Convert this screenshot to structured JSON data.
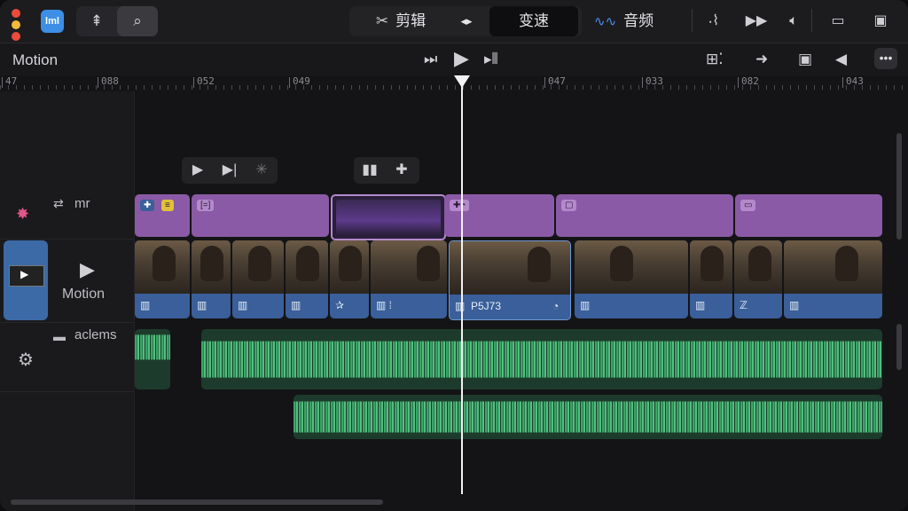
{
  "toolbar": {
    "traffic_colors": [
      "#e94b3c",
      "#f2b93b",
      "#e94b3c"
    ],
    "app_icon_label": "lml",
    "tools": [
      {
        "icon": "arrow-up-icon",
        "glyph": "⇞"
      },
      {
        "icon": "search-icon",
        "glyph": "⌕"
      }
    ],
    "segments": [
      {
        "label": "剪辑",
        "glyph": "✂",
        "selected": false
      },
      {
        "label": "◂▸",
        "glyph": "",
        "selected": false
      },
      {
        "label": "变速",
        "glyph": "",
        "selected": true
      }
    ],
    "audio_label": "音频",
    "right_icons": [
      "fx-icon",
      "fast-forward-icon",
      "volume-icon",
      "monitor-icon",
      "window-icon"
    ]
  },
  "header": {
    "title": "Motion",
    "more_label": "•••"
  },
  "ruler": {
    "ticks": [
      "47",
      "088",
      "052",
      "049",
      "047",
      "033",
      "082",
      "043"
    ]
  },
  "tracks": {
    "title_track_label": "mr",
    "video_track_label": "Motion",
    "audio_track_label": "aclems",
    "clip_label_a": "P5J73"
  },
  "colors": {
    "accent_blue": "#3d8fe6",
    "title_clip": "#8a5aa6",
    "video_clip": "#3a5f9a",
    "audio_wave": "#3fa46a"
  }
}
